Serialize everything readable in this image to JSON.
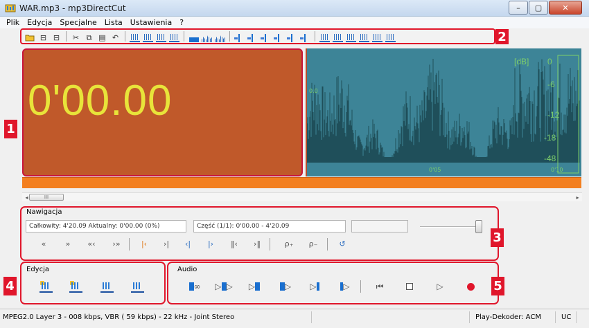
{
  "window": {
    "title": "WAR.mp3 - mp3DirectCut",
    "minimize": "–",
    "maximize": "▢",
    "close": "✕"
  },
  "menu": [
    "Plik",
    "Edycja",
    "Specjalne",
    "Lista",
    "Ustawienia",
    "?"
  ],
  "badges": [
    "1",
    "2",
    "3",
    "4",
    "5"
  ],
  "display": {
    "time": "0'00.00"
  },
  "waveform": {
    "db_unit": "[dB]",
    "db_ticks": [
      "0",
      "-6",
      "-12",
      "-18",
      "-48"
    ],
    "marker_label": "0.0",
    "time_marks": [
      "0'05",
      "0'10"
    ],
    "waveform_color": "#1f4f5a",
    "background_color": "#3d8497",
    "meter_color": "#7ecf6a"
  },
  "scrollbar": {
    "left_arrow": "◂",
    "thumb": "III",
    "right_arrow": "▸"
  },
  "navigation": {
    "label": "Nawigacja",
    "total_field": "Całkowity: 4'20.09  Aktualny: 0'00.00  (0%)",
    "part_field": "Część (1/1): 0'00.00 - 4'20.09",
    "empty_field": "",
    "volume_level_pct": 100,
    "buttons": [
      "«",
      "»",
      "«‹",
      "›»",
      "|‹",
      "›|",
      "‹|",
      "|›",
      "‖‹",
      "›‖",
      "ρ₊",
      "ρ₋",
      "↺"
    ]
  },
  "edit": {
    "label": "Edycja",
    "tools": [
      "cut-selection-tool",
      "set-volume-tool",
      "fade-in-tool",
      "fade-out-tool"
    ]
  },
  "audio": {
    "label": "Audio",
    "buttons": [
      "play-loop",
      "play-selection",
      "play-to-selection",
      "play-from-selection",
      "play-to-cursor",
      "play-from-cursor",
      "go-to-start",
      "stop",
      "play",
      "record"
    ],
    "record_color": "#e0162b"
  },
  "status": {
    "format": "MPEG2.0 Layer 3 - 008 kbps, VBR ( 59 kbps) - 22 kHz - Joint Stereo",
    "decoder": "Play-Dekoder: ACM",
    "mode": "UC"
  }
}
